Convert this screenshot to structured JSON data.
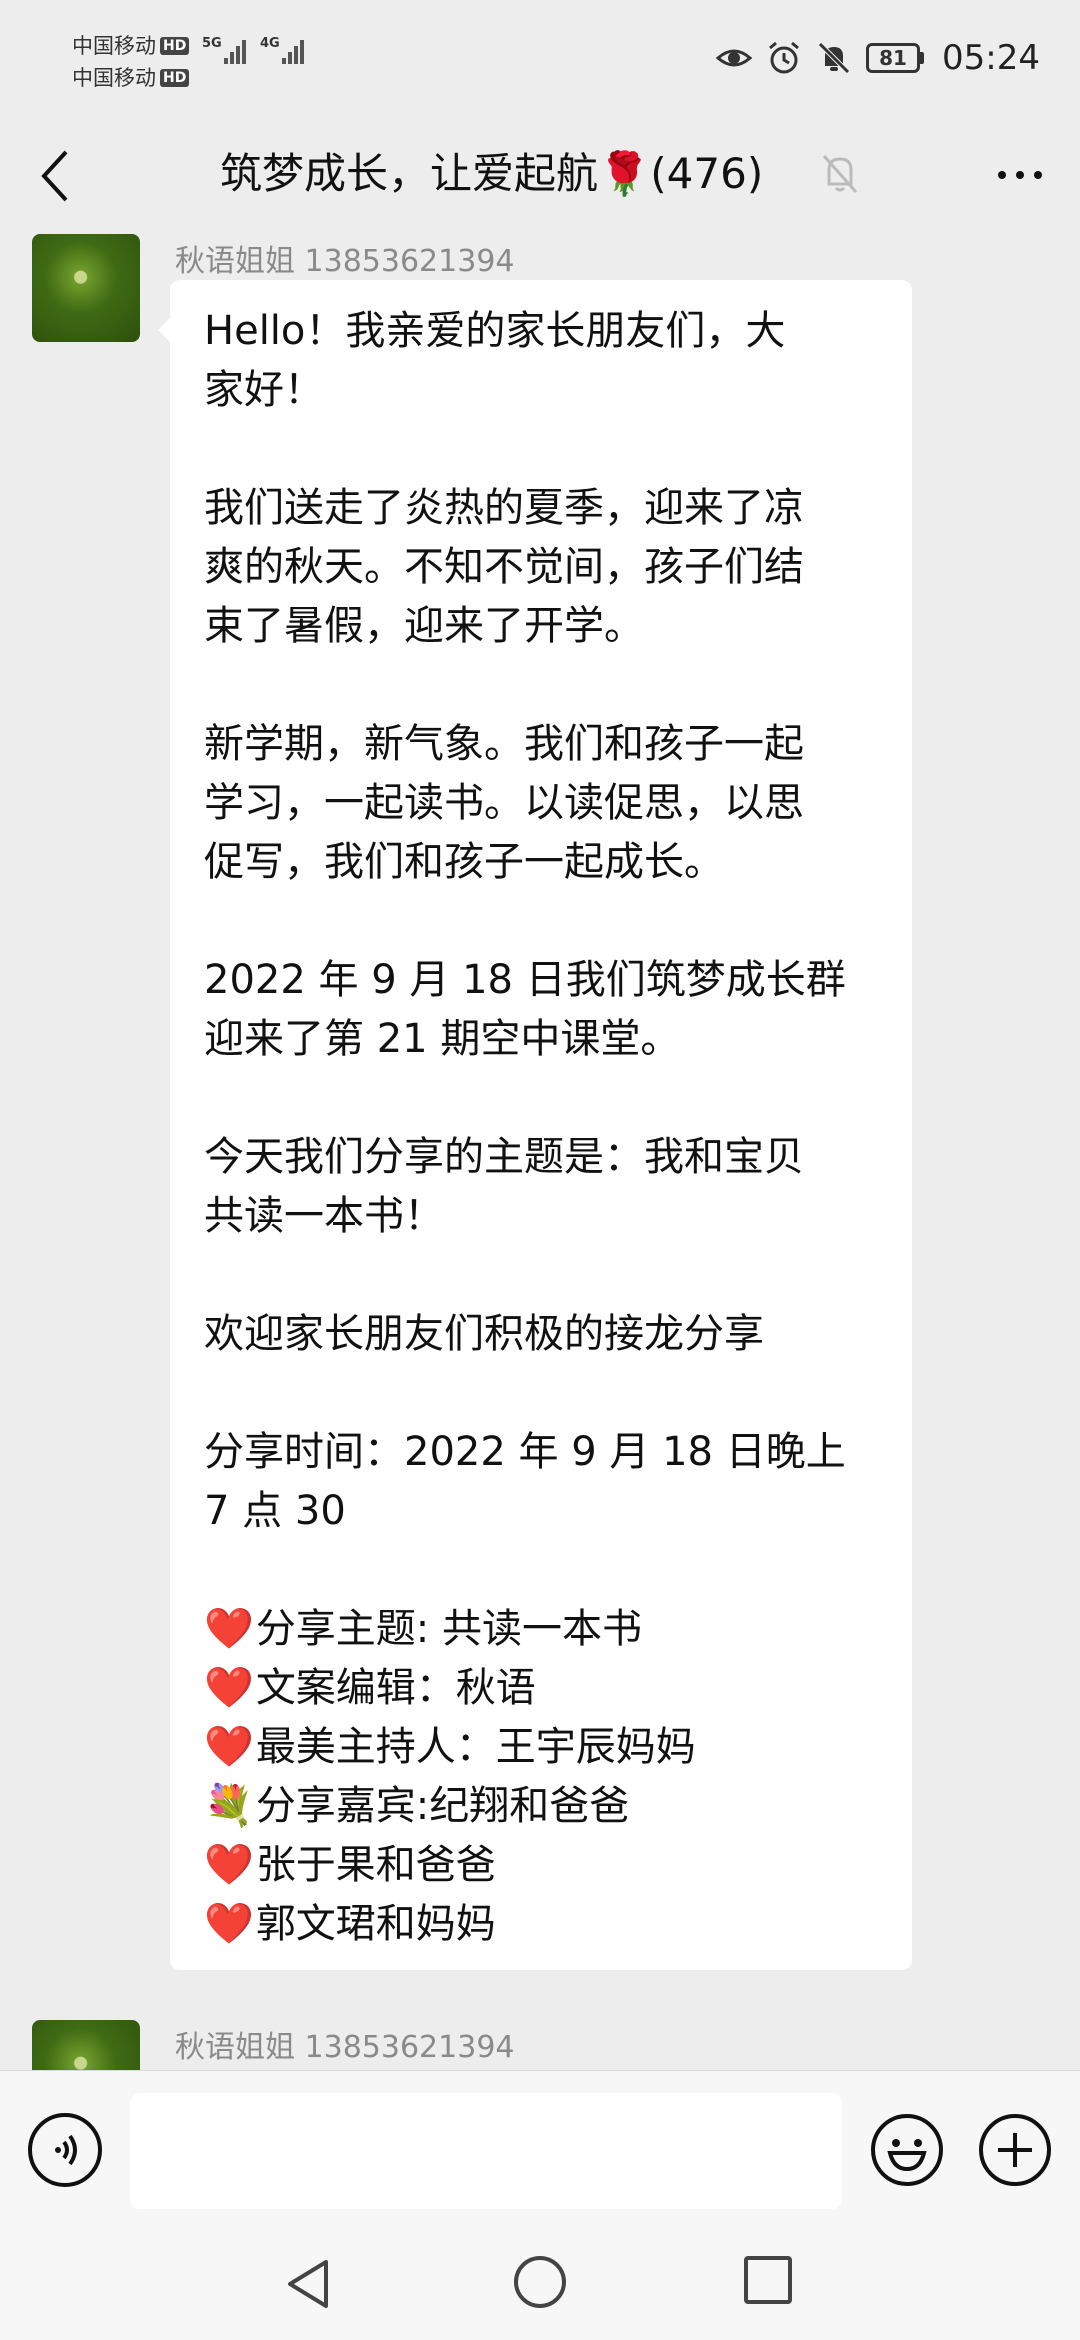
{
  "status_bar": {
    "carrier_1": "中国移动",
    "carrier_2": "中国移动",
    "hd": "HD",
    "net_1": "5G",
    "net_2": "4G",
    "battery": "81",
    "time": "05:24"
  },
  "header": {
    "title": "筑梦成长，让爱起航🌹(476)"
  },
  "messages": [
    {
      "sender": "秋语姐姐 13853621394",
      "paragraphs": [
        [
          "Hello！我亲爱的家长朋友们，大",
          "家好！"
        ],
        [
          "我们送走了炎热的夏季，迎来了凉",
          "爽的秋天。不知不觉间，孩子们结",
          "束了暑假，迎来了开学。"
        ],
        [
          "新学期，新气象。我们和孩子一起",
          "学习，一起读书。以读促思，以思",
          "促写，我们和孩子一起成长。"
        ],
        [
          "2022 年 9 月 18 日我们筑梦成长群",
          "迎来了第 21 期空中课堂。"
        ],
        [
          "今天我们分享的主题是：我和宝贝",
          "共读一本书！"
        ],
        [
          "欢迎家长朋友们积极的接龙分享"
        ],
        [
          "分享时间：2022 年 9 月 18 日晚上",
          "7 点 30"
        ]
      ],
      "list_items": [
        {
          "icon": "❤️",
          "text": "分享主题: 共读一本书"
        },
        {
          "icon": "❤️",
          "text": "文案编辑：秋语"
        },
        {
          "icon": "❤️",
          "text": "最美主持人：王宇辰妈妈"
        },
        {
          "icon": "💐",
          "text": "分享嘉宾:纪翔和爸爸"
        },
        {
          "icon": "❤️",
          "text": "张于果和爸爸"
        },
        {
          "icon": "❤️",
          "text": "郭文珺和妈妈"
        }
      ]
    },
    {
      "sender": "秋语姐姐 13853621394"
    }
  ],
  "input": {
    "placeholder": ""
  }
}
